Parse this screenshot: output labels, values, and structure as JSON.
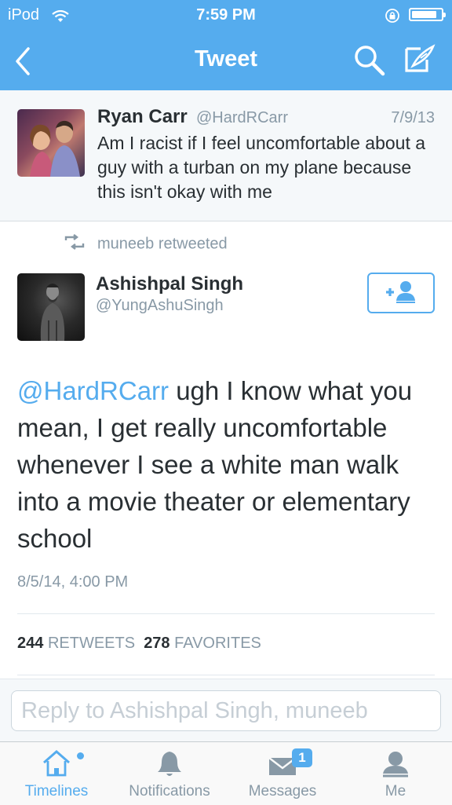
{
  "status_bar": {
    "carrier": "iPod",
    "time": "7:59 PM",
    "battery_level": 0.85
  },
  "nav": {
    "title": "Tweet",
    "icons": [
      "back-chevron-icon",
      "search-icon",
      "compose-icon"
    ]
  },
  "original_tweet": {
    "name": "Ryan Carr",
    "handle": "@HardRCarr",
    "date": "7/9/13",
    "text": "Am I racist if I feel uncomfortable about a guy with a turban on my plane because this isn't okay with me"
  },
  "retweet": {
    "label": "muneeb retweeted"
  },
  "tweet": {
    "author_name": "Ashishpal Singh",
    "author_handle": "@YungAshuSingh",
    "mention": "@HardRCarr",
    "text": " ugh I know what you mean, I get really uncomfortable whenever I see a white man walk into a movie theater or elementary school",
    "timestamp": "8/5/14, 4:00 PM",
    "retweets_count": "244",
    "retweets_label": "RETWEETS",
    "favorites_count": "278",
    "favorites_label": "FAVORITES"
  },
  "reply": {
    "placeholder": "Reply to Ashishpal Singh, muneeb"
  },
  "tabs": [
    {
      "label": "Timelines",
      "icon": "home-icon",
      "active": true
    },
    {
      "label": "Notifications",
      "icon": "bell-icon",
      "active": false
    },
    {
      "label": "Messages",
      "icon": "envelope-icon",
      "active": false,
      "badge": "1"
    },
    {
      "label": "Me",
      "icon": "person-icon",
      "active": false
    }
  ],
  "colors": {
    "accent": "#55acee",
    "muted": "#8899a6",
    "text": "#292f33"
  }
}
